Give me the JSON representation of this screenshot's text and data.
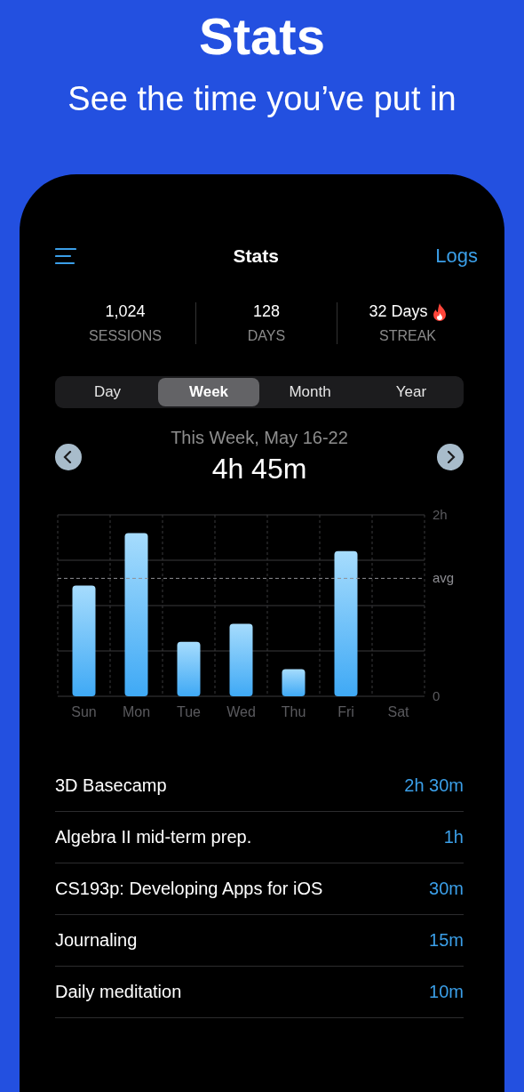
{
  "headline": {
    "title": "Stats",
    "subtitle": "See the time you’ve put in"
  },
  "nav": {
    "title": "Stats",
    "action": "Logs"
  },
  "stats": [
    {
      "value": "1,024",
      "label": "SESSIONS",
      "flame": false
    },
    {
      "value": "128",
      "label": "DAYS",
      "flame": false
    },
    {
      "value": "32 Days",
      "label": "STREAK",
      "flame": true
    }
  ],
  "tabs": [
    {
      "label": "Day",
      "selected": false
    },
    {
      "label": "Week",
      "selected": true
    },
    {
      "label": "Month",
      "selected": false
    },
    {
      "label": "Year",
      "selected": false
    }
  ],
  "period": {
    "label": "This Week, May 16-22",
    "total": "4h 45m"
  },
  "chart_data": {
    "type": "bar",
    "categories": [
      "Sun",
      "Mon",
      "Tue",
      "Wed",
      "Thu",
      "Fri",
      "Sat"
    ],
    "series": [
      {
        "color": "#3fa9f5",
        "values": [
          1.22,
          1.8,
          0.6,
          0.8,
          0.3,
          1.6,
          0
        ]
      }
    ],
    "ylim": [
      0,
      2
    ],
    "yticks": [
      {
        "value": 0,
        "label": "0"
      },
      {
        "value": 2,
        "label": "2h"
      }
    ],
    "ref_lines": [
      {
        "axis": "y",
        "value": 1.3,
        "label": "avg"
      }
    ]
  },
  "projects": [
    {
      "name": "3D Basecamp",
      "time": "2h 30m"
    },
    {
      "name": "Algebra II mid-term prep.",
      "time": "1h"
    },
    {
      "name": "CS193p: Developing Apps for iOS",
      "time": "30m"
    },
    {
      "name": "Journaling",
      "time": "15m"
    },
    {
      "name": "Daily meditation",
      "time": "10m"
    }
  ]
}
